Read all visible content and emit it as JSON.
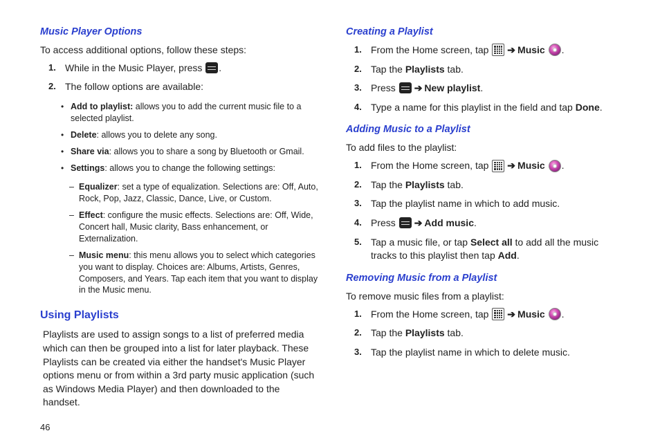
{
  "page_number": "46",
  "left": {
    "h3_music_player_options": "Music Player Options",
    "intro_mpo": "To access additional options, follow these steps:",
    "step1_a": "While in the Music Player, press ",
    "step1_b": ".",
    "step2": "The follow options are available:",
    "bullet_addtoplaylist_label": "Add to playlist:",
    "bullet_addtoplaylist_text": " allows you to add the current music file to a selected playlist.",
    "bullet_delete_label": "Delete",
    "bullet_delete_text": ": allows you to delete any song.",
    "bullet_sharevia_label": "Share via",
    "bullet_sharevia_text": ": allows you to share a song by Bluetooth or Gmail.",
    "bullet_settings_label": "Settings",
    "bullet_settings_text": ": allows you to change the following settings:",
    "dash_equalizer_label": "Equalizer",
    "dash_equalizer_text": ": set a type of equalization. Selections are: Off, Auto, Rock, Pop, Jazz, Classic, Dance, Live, or Custom.",
    "dash_effect_label": "Effect",
    "dash_effect_text": ": configure the music effects. Selections are: Off, Wide, Concert hall, Music clarity, Bass enhancement, or Externalization.",
    "dash_musicmenu_label": "Music menu",
    "dash_musicmenu_text": ": this menu allows you to select which categories you want to display. Choices are: Albums, Artists, Genres, Composers, and Years. Tap each item that you want to display in the Music menu.",
    "h2_using_playlists": "Using Playlists",
    "using_playlists_para": "Playlists are used to assign songs to a list of preferred media which can then be grouped into a list for later playback. These Playlists can be created via either the handset's Music Player options menu or from within a 3rd party music application (such as Windows Media Player) and then downloaded to the handset."
  },
  "right": {
    "h3_creating": "Creating a Playlist",
    "cp_s1_a": "From the Home screen, tap ",
    "cp_s1_b": " ",
    "cp_s1_music": "Music",
    "cp_s1_c": ".",
    "cp_s2_a": "Tap the ",
    "cp_s2_playlists": "Playlists",
    "cp_s2_b": " tab.",
    "cp_s3_a": "Press ",
    "cp_s3_b": " ",
    "cp_s3_new": "New playlist",
    "cp_s3_c": ".",
    "cp_s4_a": "Type a name for this playlist in the field and tap ",
    "cp_s4_done": "Done",
    "cp_s4_b": ".",
    "h3_adding": "Adding Music to a Playlist",
    "am_intro": "To add files to the playlist:",
    "am_s1_a": "From the Home screen, tap ",
    "am_s1_music": "Music",
    "am_s1_c": ".",
    "am_s2_a": "Tap the ",
    "am_s2_playlists": "Playlists",
    "am_s2_b": " tab.",
    "am_s3": "Tap the playlist name in which to add music.",
    "am_s4_a": "Press ",
    "am_s4_add": "Add music",
    "am_s4_b": ".",
    "am_s5_a": "Tap a music file, or tap ",
    "am_s5_selectall": "Select all",
    "am_s5_b": " to add all the music tracks to this playlist then tap ",
    "am_s5_add": "Add",
    "am_s5_c": ".",
    "h3_removing": "Removing Music from a Playlist",
    "rm_intro": "To remove music files from a playlist:",
    "rm_s1_a": "From the Home screen, tap ",
    "rm_s1_music": "Music",
    "rm_s1_c": ".",
    "rm_s2_a": "Tap the ",
    "rm_s2_playlists": "Playlists",
    "rm_s2_b": " tab.",
    "rm_s3": "Tap the playlist name in which to delete music."
  },
  "arrow": "➔"
}
